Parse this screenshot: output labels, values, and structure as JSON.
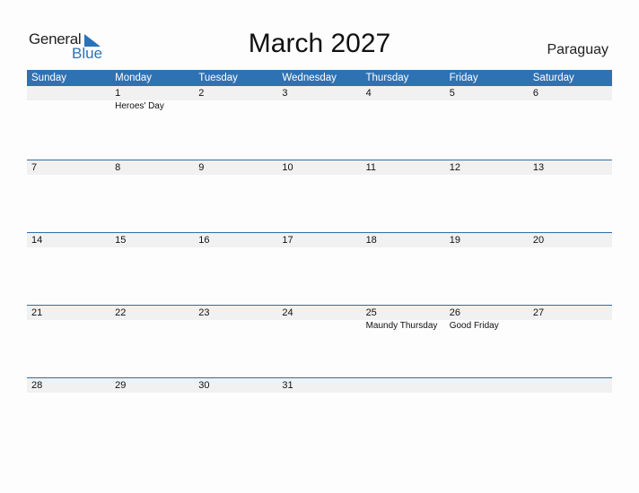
{
  "logo": {
    "word1": "General",
    "word2": "Blue"
  },
  "title": "March 2027",
  "country": "Paraguay",
  "colors": {
    "accent": "#2f72b3",
    "band": "#f1f1f1"
  },
  "weekdays": [
    "Sunday",
    "Monday",
    "Tuesday",
    "Wednesday",
    "Thursday",
    "Friday",
    "Saturday"
  ],
  "weeks": [
    [
      {
        "day": "",
        "event": ""
      },
      {
        "day": "1",
        "event": "Heroes' Day"
      },
      {
        "day": "2",
        "event": ""
      },
      {
        "day": "3",
        "event": ""
      },
      {
        "day": "4",
        "event": ""
      },
      {
        "day": "5",
        "event": ""
      },
      {
        "day": "6",
        "event": ""
      }
    ],
    [
      {
        "day": "7",
        "event": ""
      },
      {
        "day": "8",
        "event": ""
      },
      {
        "day": "9",
        "event": ""
      },
      {
        "day": "10",
        "event": ""
      },
      {
        "day": "11",
        "event": ""
      },
      {
        "day": "12",
        "event": ""
      },
      {
        "day": "13",
        "event": ""
      }
    ],
    [
      {
        "day": "14",
        "event": ""
      },
      {
        "day": "15",
        "event": ""
      },
      {
        "day": "16",
        "event": ""
      },
      {
        "day": "17",
        "event": ""
      },
      {
        "day": "18",
        "event": ""
      },
      {
        "day": "19",
        "event": ""
      },
      {
        "day": "20",
        "event": ""
      }
    ],
    [
      {
        "day": "21",
        "event": ""
      },
      {
        "day": "22",
        "event": ""
      },
      {
        "day": "23",
        "event": ""
      },
      {
        "day": "24",
        "event": ""
      },
      {
        "day": "25",
        "event": "Maundy Thursday"
      },
      {
        "day": "26",
        "event": "Good Friday"
      },
      {
        "day": "27",
        "event": ""
      }
    ],
    [
      {
        "day": "28",
        "event": ""
      },
      {
        "day": "29",
        "event": ""
      },
      {
        "day": "30",
        "event": ""
      },
      {
        "day": "31",
        "event": ""
      },
      {
        "day": "",
        "event": ""
      },
      {
        "day": "",
        "event": ""
      },
      {
        "day": "",
        "event": ""
      }
    ]
  ]
}
